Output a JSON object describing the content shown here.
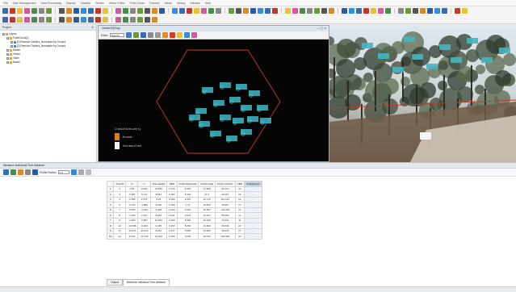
{
  "menu": {
    "items": [
      "File",
      "Data Management",
      "Data Processing",
      "Display",
      "Classify",
      "Terrain",
      "Vector Editor",
      "Point Cloud",
      "Forestry",
      "Urban",
      "Mining",
      "Window",
      "Help"
    ]
  },
  "project_panel": {
    "title": "Project",
    "items": [
      {
        "label": "Layers",
        "level": 0
      },
      {
        "label": "PointCloud(1)",
        "level": 1
      },
      {
        "label": "[1] Remove Outliers_Normalize by Ground",
        "level": 2
      },
      {
        "label": "[2] Remove Outliers_Normalize by Ground",
        "level": 2
      },
      {
        "label": "Raster",
        "level": 1
      },
      {
        "label": "Vector",
        "level": 1
      },
      {
        "label": "Table",
        "level": 1
      },
      {
        "label": "Model",
        "level": 1
      }
    ]
  },
  "viewer_left": {
    "title": "Viewer2D(Top)",
    "toolbar_label": "Editor",
    "field_value": "Tree ID",
    "legend": [
      "Classification(s)",
      "-Ground",
      "-Unclassified"
    ]
  },
  "lower_panel": {
    "title": "Measure Individual Tree Attribute",
    "profile_label": "Profile Radius",
    "profile_value": "1.0"
  },
  "table": {
    "columns": [
      "",
      "Tree ID",
      "X",
      "Y",
      "Tree Height",
      "DBH",
      "Crown Diameter",
      "Crown Area",
      "Crown Volume",
      "CBH",
      "Straightness"
    ],
    "rows": [
      [
        "1",
        "3",
        "4.86",
        "-8.632",
        "13.684",
        "0.279",
        "5.963",
        "27.928",
        "91.213",
        "10",
        "-"
      ],
      [
        "2",
        "4",
        "-3.987",
        "-5.721",
        "8.814",
        "0.287",
        "5.244",
        "21.6",
        "40.267",
        "15",
        "-"
      ],
      [
        "3",
        "5",
        "-2.385",
        "2.975",
        "8.26",
        "0.259",
        "4.607",
        "16.716",
        "110.012",
        "14",
        "-"
      ],
      [
        "4",
        "6",
        "-0.733",
        "-3.986",
        "8.166",
        "0.159",
        "3.71",
        "10.812",
        "34.567",
        "17",
        "-"
      ],
      [
        "5",
        "7",
        "-5.683",
        "-3.619",
        "9.428",
        "0.243",
        "6.532",
        "33.507",
        "142.289",
        "13",
        "-"
      ],
      [
        "6",
        "8",
        "-7.266",
        "-0.157",
        "8.844",
        "0.241",
        "4.575",
        "16.437",
        "55.656",
        "12",
        "-"
      ],
      [
        "7",
        "9",
        "-4.462",
        "-0.587",
        "10.654",
        "0.209",
        "5.081",
        "20.339",
        "74.021",
        "11",
        "-"
      ],
      [
        "8",
        "10",
        "-13.568",
        "-9.923",
        "9.435",
        "0.253",
        "5.252",
        "21.816",
        "66.846",
        "20",
        "-"
      ],
      [
        "9",
        "11",
        "-12.874",
        "-13.014",
        "8.251",
        "0.217",
        "3.653",
        "10.466",
        "36.036",
        "27",
        "-"
      ],
      [
        "10",
        "12",
        "-8.331",
        "-15.125",
        "10.004",
        "0.269",
        "6.045",
        "28.705",
        "120.996",
        "20",
        "-"
      ]
    ]
  },
  "bottom_tabs": [
    "Output",
    "Measure Individual Tree Attribute"
  ],
  "status": ""
}
